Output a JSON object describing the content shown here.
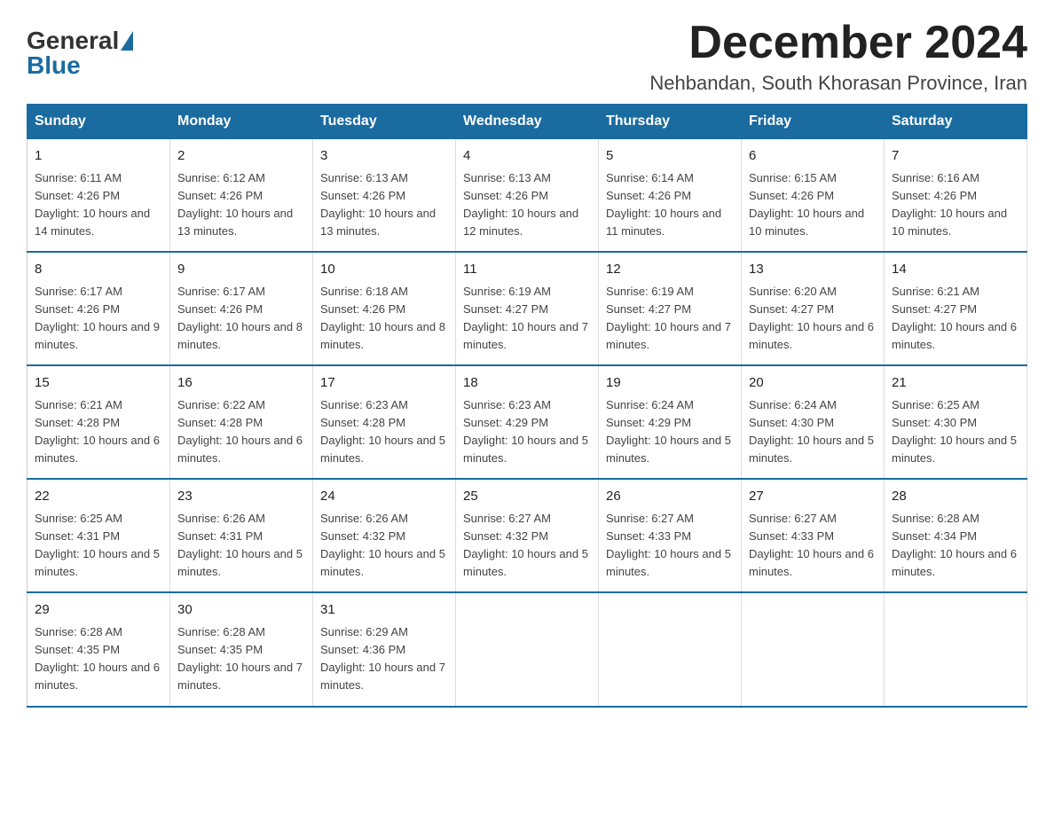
{
  "logo": {
    "text_general": "General",
    "text_blue": "Blue"
  },
  "title": "December 2024",
  "subtitle": "Nehbandan, South Khorasan Province, Iran",
  "header_days": [
    "Sunday",
    "Monday",
    "Tuesday",
    "Wednesday",
    "Thursday",
    "Friday",
    "Saturday"
  ],
  "weeks": [
    [
      {
        "day": "1",
        "sunrise": "6:11 AM",
        "sunset": "4:26 PM",
        "daylight": "10 hours and 14 minutes."
      },
      {
        "day": "2",
        "sunrise": "6:12 AM",
        "sunset": "4:26 PM",
        "daylight": "10 hours and 13 minutes."
      },
      {
        "day": "3",
        "sunrise": "6:13 AM",
        "sunset": "4:26 PM",
        "daylight": "10 hours and 13 minutes."
      },
      {
        "day": "4",
        "sunrise": "6:13 AM",
        "sunset": "4:26 PM",
        "daylight": "10 hours and 12 minutes."
      },
      {
        "day": "5",
        "sunrise": "6:14 AM",
        "sunset": "4:26 PM",
        "daylight": "10 hours and 11 minutes."
      },
      {
        "day": "6",
        "sunrise": "6:15 AM",
        "sunset": "4:26 PM",
        "daylight": "10 hours and 10 minutes."
      },
      {
        "day": "7",
        "sunrise": "6:16 AM",
        "sunset": "4:26 PM",
        "daylight": "10 hours and 10 minutes."
      }
    ],
    [
      {
        "day": "8",
        "sunrise": "6:17 AM",
        "sunset": "4:26 PM",
        "daylight": "10 hours and 9 minutes."
      },
      {
        "day": "9",
        "sunrise": "6:17 AM",
        "sunset": "4:26 PM",
        "daylight": "10 hours and 8 minutes."
      },
      {
        "day": "10",
        "sunrise": "6:18 AM",
        "sunset": "4:26 PM",
        "daylight": "10 hours and 8 minutes."
      },
      {
        "day": "11",
        "sunrise": "6:19 AM",
        "sunset": "4:27 PM",
        "daylight": "10 hours and 7 minutes."
      },
      {
        "day": "12",
        "sunrise": "6:19 AM",
        "sunset": "4:27 PM",
        "daylight": "10 hours and 7 minutes."
      },
      {
        "day": "13",
        "sunrise": "6:20 AM",
        "sunset": "4:27 PM",
        "daylight": "10 hours and 6 minutes."
      },
      {
        "day": "14",
        "sunrise": "6:21 AM",
        "sunset": "4:27 PM",
        "daylight": "10 hours and 6 minutes."
      }
    ],
    [
      {
        "day": "15",
        "sunrise": "6:21 AM",
        "sunset": "4:28 PM",
        "daylight": "10 hours and 6 minutes."
      },
      {
        "day": "16",
        "sunrise": "6:22 AM",
        "sunset": "4:28 PM",
        "daylight": "10 hours and 6 minutes."
      },
      {
        "day": "17",
        "sunrise": "6:23 AM",
        "sunset": "4:28 PM",
        "daylight": "10 hours and 5 minutes."
      },
      {
        "day": "18",
        "sunrise": "6:23 AM",
        "sunset": "4:29 PM",
        "daylight": "10 hours and 5 minutes."
      },
      {
        "day": "19",
        "sunrise": "6:24 AM",
        "sunset": "4:29 PM",
        "daylight": "10 hours and 5 minutes."
      },
      {
        "day": "20",
        "sunrise": "6:24 AM",
        "sunset": "4:30 PM",
        "daylight": "10 hours and 5 minutes."
      },
      {
        "day": "21",
        "sunrise": "6:25 AM",
        "sunset": "4:30 PM",
        "daylight": "10 hours and 5 minutes."
      }
    ],
    [
      {
        "day": "22",
        "sunrise": "6:25 AM",
        "sunset": "4:31 PM",
        "daylight": "10 hours and 5 minutes."
      },
      {
        "day": "23",
        "sunrise": "6:26 AM",
        "sunset": "4:31 PM",
        "daylight": "10 hours and 5 minutes."
      },
      {
        "day": "24",
        "sunrise": "6:26 AM",
        "sunset": "4:32 PM",
        "daylight": "10 hours and 5 minutes."
      },
      {
        "day": "25",
        "sunrise": "6:27 AM",
        "sunset": "4:32 PM",
        "daylight": "10 hours and 5 minutes."
      },
      {
        "day": "26",
        "sunrise": "6:27 AM",
        "sunset": "4:33 PM",
        "daylight": "10 hours and 5 minutes."
      },
      {
        "day": "27",
        "sunrise": "6:27 AM",
        "sunset": "4:33 PM",
        "daylight": "10 hours and 6 minutes."
      },
      {
        "day": "28",
        "sunrise": "6:28 AM",
        "sunset": "4:34 PM",
        "daylight": "10 hours and 6 minutes."
      }
    ],
    [
      {
        "day": "29",
        "sunrise": "6:28 AM",
        "sunset": "4:35 PM",
        "daylight": "10 hours and 6 minutes."
      },
      {
        "day": "30",
        "sunrise": "6:28 AM",
        "sunset": "4:35 PM",
        "daylight": "10 hours and 7 minutes."
      },
      {
        "day": "31",
        "sunrise": "6:29 AM",
        "sunset": "4:36 PM",
        "daylight": "10 hours and 7 minutes."
      },
      null,
      null,
      null,
      null
    ]
  ]
}
